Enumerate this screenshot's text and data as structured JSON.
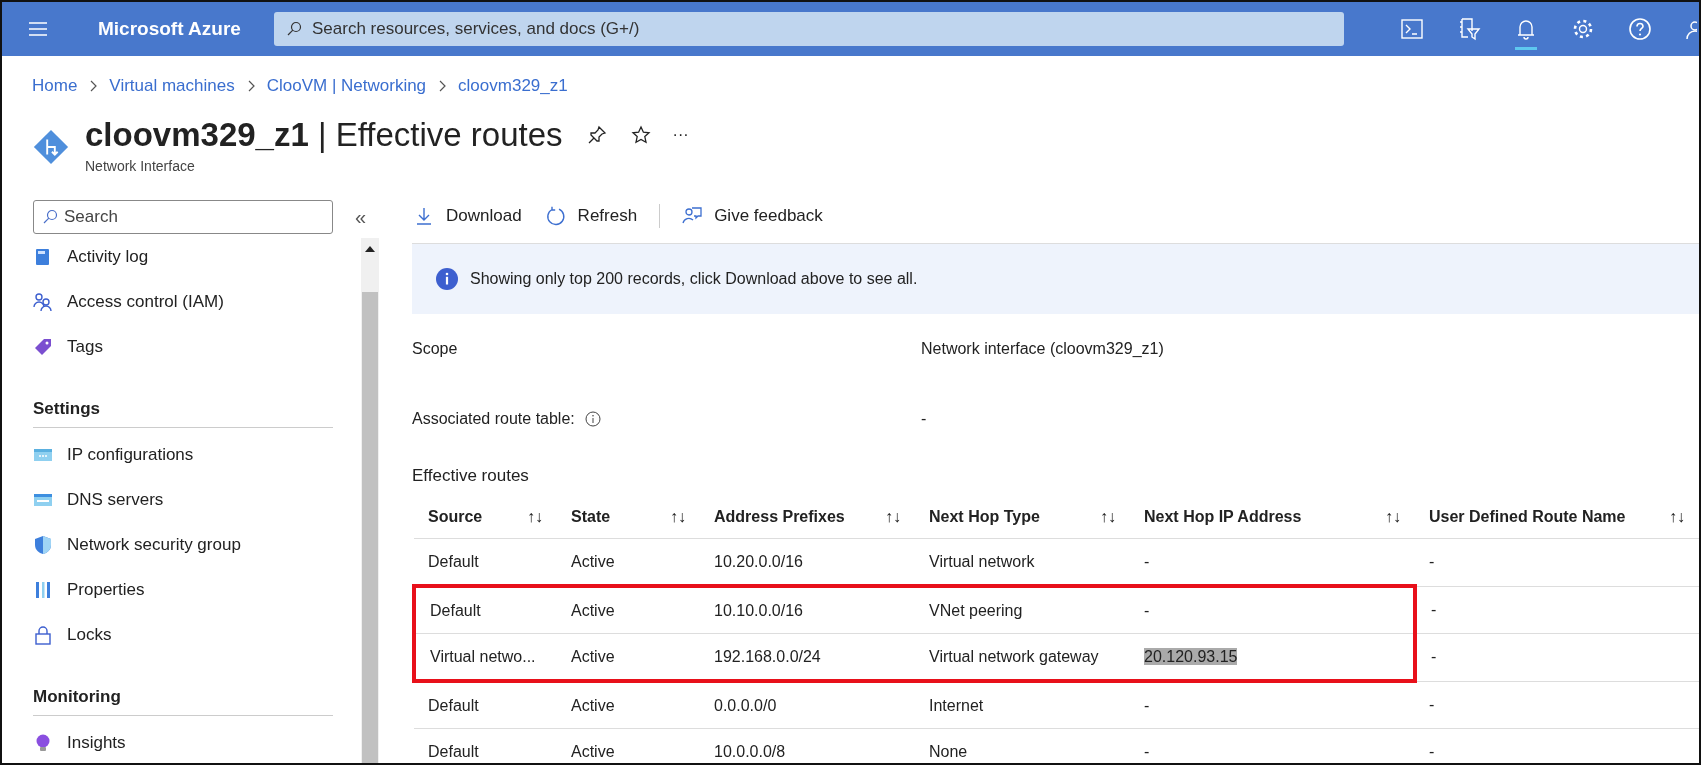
{
  "topbar": {
    "brand": "Microsoft Azure",
    "search_placeholder": "Search resources, services, and docs (G+/)"
  },
  "breadcrumb": [
    "Home",
    "Virtual machines",
    "ClooVM | Networking",
    "cloovm329_z1"
  ],
  "page": {
    "title_bold": "cloovm329_z1",
    "title_rest": "| Effective routes",
    "subtitle": "Network Interface",
    "more": "···"
  },
  "sidebar": {
    "search_placeholder": "Search",
    "collapse": "«",
    "sections": [
      {
        "items": [
          {
            "label": "Activity log"
          },
          {
            "label": "Access control (IAM)"
          },
          {
            "label": "Tags"
          }
        ]
      },
      {
        "heading": "Settings",
        "items": [
          {
            "label": "IP configurations"
          },
          {
            "label": "DNS servers"
          },
          {
            "label": "Network security group"
          },
          {
            "label": "Properties"
          },
          {
            "label": "Locks"
          }
        ]
      },
      {
        "heading": "Monitoring",
        "items": [
          {
            "label": "Insights"
          }
        ]
      }
    ]
  },
  "toolbar": [
    {
      "label": "Download"
    },
    {
      "label": "Refresh"
    },
    {
      "label": "Give feedback"
    }
  ],
  "info_banner": "Showing only top 200 records, click Download above to see all.",
  "fields": [
    {
      "label": "Scope",
      "value": "Network interface (cloovm329_z1)"
    },
    {
      "label": "Associated route table:",
      "value": "-",
      "info": true
    }
  ],
  "table": {
    "title": "Effective routes",
    "columns": [
      {
        "label": "Source",
        "sort": "↑↓"
      },
      {
        "label": "State",
        "sort": "↑↓"
      },
      {
        "label": "Address Prefixes",
        "sort": "↑↓"
      },
      {
        "label": "Next Hop Type",
        "sort": "↑↓"
      },
      {
        "label": "Next Hop IP Address",
        "sort": "↑↓"
      },
      {
        "label": "User Defined Route Name",
        "sort": "↑↓"
      }
    ],
    "rows": [
      {
        "cells": [
          "Default",
          "Active",
          "10.20.0.0/16",
          "Virtual network",
          "-",
          "-"
        ],
        "highlighted": false,
        "ip_selected": false
      },
      {
        "cells": [
          "Default",
          "Active",
          "10.10.0.0/16",
          "VNet peering",
          "-",
          "-"
        ],
        "highlighted": true,
        "ip_selected": false
      },
      {
        "cells": [
          "Virtual netwo...",
          "Active",
          "192.168.0.0/24",
          "Virtual network gateway",
          "20.120.93.15",
          "-"
        ],
        "highlighted": true,
        "ip_selected": true
      },
      {
        "cells": [
          "Default",
          "Active",
          "0.0.0.0/0",
          "Internet",
          "-",
          "-"
        ],
        "highlighted": false,
        "ip_selected": false
      },
      {
        "cells": [
          "Default",
          "Active",
          "10.0.0.0/8",
          "None",
          "-",
          "-"
        ],
        "highlighted": false,
        "ip_selected": false
      }
    ]
  }
}
